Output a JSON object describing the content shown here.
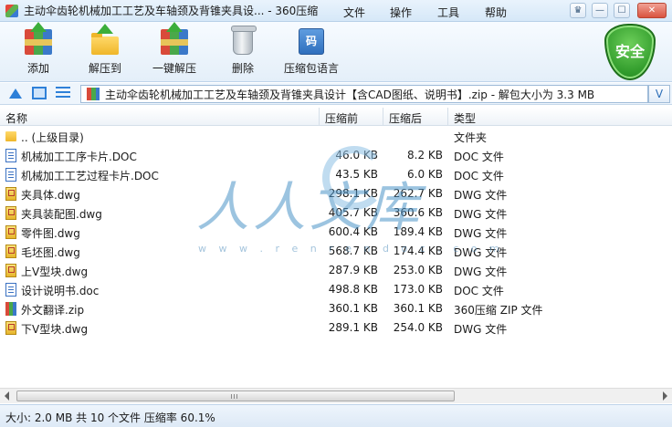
{
  "window": {
    "title": "主动伞齿轮机械加工工艺及车轴颈及背锥夹具设... - 360压缩",
    "menu": [
      "文件",
      "操作",
      "工具",
      "帮助"
    ],
    "controls": {
      "skin": "♛",
      "minimize": "—",
      "maximize": "☐",
      "close": "✕"
    }
  },
  "toolbar": {
    "add": "添加",
    "extract_to": "解压到",
    "one_click_extract": "一键解压",
    "delete": "删除",
    "archive_language": "压缩包语言",
    "codebook_glyph": "码",
    "security_badge": "安全"
  },
  "address": {
    "path": "主动伞齿轮机械加工工艺及车轴颈及背锥夹具设计【含CAD图纸、说明书】.zip - 解包大小为 3.3 MB",
    "dropdown": "V"
  },
  "list": {
    "columns": {
      "name": "名称",
      "compressed": "压缩前",
      "after": "压缩后",
      "type": "类型"
    },
    "rows": [
      {
        "name": ".. (上级目录)",
        "before": "",
        "after": "",
        "type": "文件夹",
        "icon": "folder"
      },
      {
        "name": "机械加工工序卡片.DOC",
        "before": "46.0 KB",
        "after": "8.2 KB",
        "type": "DOC 文件",
        "icon": "doc"
      },
      {
        "name": "机械加工工艺过程卡片.DOC",
        "before": "43.5 KB",
        "after": "6.0 KB",
        "type": "DOC 文件",
        "icon": "doc"
      },
      {
        "name": "夹具体.dwg",
        "before": "298.1 KB",
        "after": "262.7 KB",
        "type": "DWG 文件",
        "icon": "dwg"
      },
      {
        "name": "夹具装配图.dwg",
        "before": "405.7 KB",
        "after": "360.6 KB",
        "type": "DWG 文件",
        "icon": "dwg"
      },
      {
        "name": "零件图.dwg",
        "before": "600.4 KB",
        "after": "189.4 KB",
        "type": "DWG 文件",
        "icon": "dwg"
      },
      {
        "name": "毛坯图.dwg",
        "before": "568.7 KB",
        "after": "174.4 KB",
        "type": "DWG 文件",
        "icon": "dwg"
      },
      {
        "name": "上V型块.dwg",
        "before": "287.9 KB",
        "after": "253.0 KB",
        "type": "DWG 文件",
        "icon": "dwg"
      },
      {
        "name": "设计说明书.doc",
        "before": "498.8 KB",
        "after": "173.0 KB",
        "type": "DOC 文件",
        "icon": "doc"
      },
      {
        "name": "外文翻译.zip",
        "before": "360.1 KB",
        "after": "360.1 KB",
        "type": "360压缩 ZIP 文件",
        "icon": "zip"
      },
      {
        "name": "下V型块.dwg",
        "before": "289.1 KB",
        "after": "254.0 KB",
        "type": "DWG 文件",
        "icon": "dwg"
      }
    ]
  },
  "watermark": {
    "text": "人人文库",
    "url": "w w w . r e n r e n d o c . c o m"
  },
  "status": {
    "text": "大小: 2.0 MB 共 10 个文件 压缩率 60.1%"
  }
}
